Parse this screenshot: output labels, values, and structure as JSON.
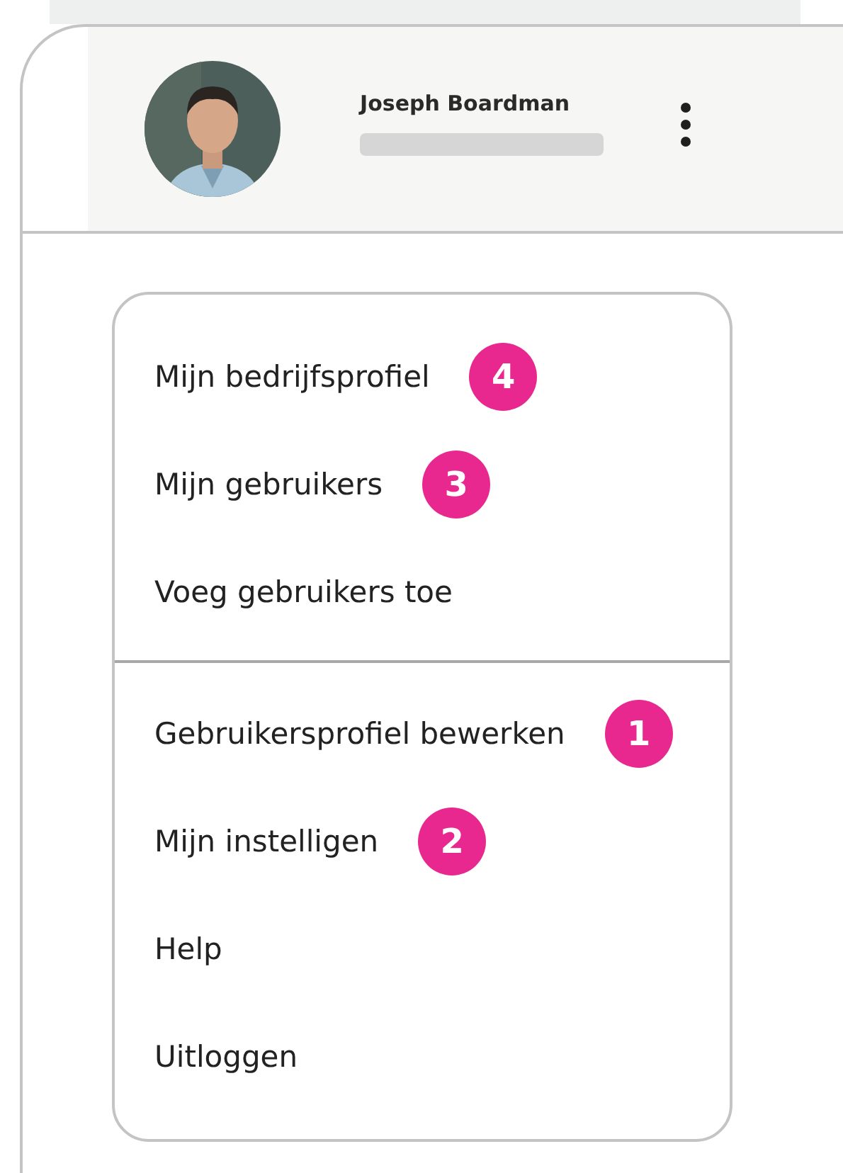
{
  "profile": {
    "name": "Joseph Boardman"
  },
  "menu": {
    "groups": [
      {
        "items": [
          {
            "label": "Mijn bedrijfsprofiel",
            "badge": "4"
          },
          {
            "label": "Mijn gebruikers",
            "badge": "3"
          },
          {
            "label": "Voeg gebruikers toe"
          }
        ]
      },
      {
        "items": [
          {
            "label": "Gebruikersprofiel bewerken",
            "badge": "1"
          },
          {
            "label": "Mijn instelligen",
            "badge": "2"
          },
          {
            "label": "Help"
          },
          {
            "label": "Uitloggen"
          }
        ]
      }
    ]
  }
}
